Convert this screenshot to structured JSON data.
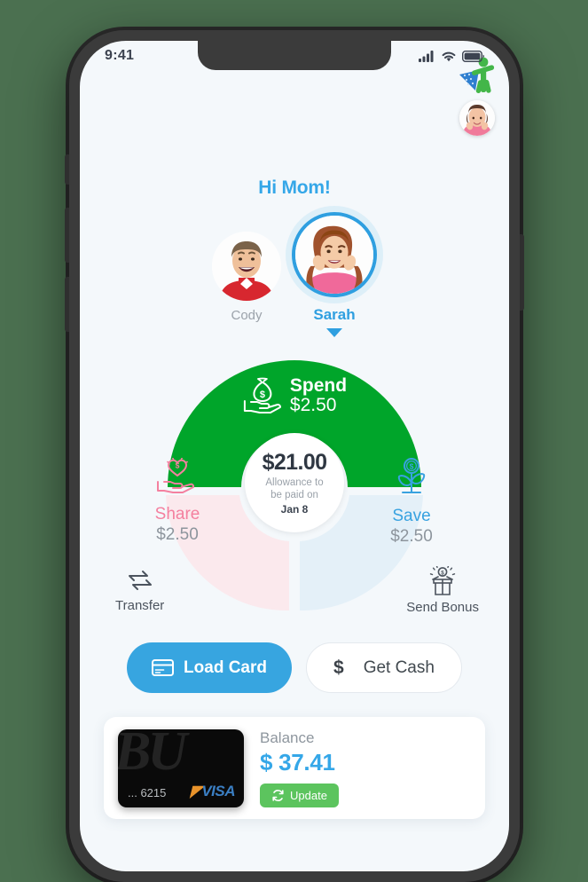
{
  "background_color": "#4b7050",
  "phone": {
    "status_bar": {
      "time": "9:41",
      "icons": [
        "cellular-signal-icon",
        "wifi-icon",
        "battery-icon"
      ]
    }
  },
  "header": {
    "greeting": "Hi Mom!",
    "app_badge_icon": "kid-with-money-logo",
    "parent_avatar_icon": "parent-avatar"
  },
  "kids": [
    {
      "name": "Cody",
      "active": false,
      "avatar_icon": "kid-avatar-cody"
    },
    {
      "name": "Sarah",
      "active": true,
      "avatar_icon": "kid-avatar-sarah"
    }
  ],
  "allowance": {
    "amount": "$21.00",
    "caption_line1": "Allowance to",
    "caption_line2": "be paid on",
    "date": "Jan 8"
  },
  "buckets": [
    {
      "key": "spend",
      "label": "Spend",
      "amount": "$2.50",
      "color": "#00a52a",
      "icon": "money-bag-in-hand-icon",
      "active": true
    },
    {
      "key": "share",
      "label": "Share",
      "amount": "$2.50",
      "color": "#f4809f",
      "fill": "#fbe9ed",
      "icon": "heart-in-hand-icon",
      "active": false
    },
    {
      "key": "save",
      "label": "Save",
      "amount": "$2.50",
      "color": "#38a2e0",
      "fill": "#e4f0f8",
      "icon": "money-plant-icon",
      "active": false
    }
  ],
  "quick_actions": [
    {
      "key": "transfer",
      "label": "Transfer",
      "icon": "transfer-arrows-icon"
    },
    {
      "key": "send_bonus",
      "label": "Send Bonus",
      "icon": "gift-bonus-icon"
    }
  ],
  "cta": {
    "load_card": {
      "label": "Load Card",
      "icon": "credit-card-icon",
      "color": "#37a5e0"
    },
    "get_cash": {
      "label": "Get Cash",
      "icon": "dollar-sign-icon"
    }
  },
  "balance_panel": {
    "card": {
      "last4": "... 6215",
      "network": "VISA",
      "art_text": "BU"
    },
    "balance_label": "Balance",
    "balance_amount": "$ 37.41",
    "update_button": {
      "label": "Update",
      "icon": "refresh-icon",
      "color": "#5cc45e"
    }
  },
  "chart_data": {
    "type": "pie",
    "title": "Allowance split",
    "categories": [
      "Spend",
      "Share",
      "Save"
    ],
    "values": [
      2.5,
      2.5,
      2.5
    ],
    "colors": [
      "#00a52a",
      "#fbe9ed",
      "#e4f0f8"
    ],
    "center_label": "$21.00",
    "legend": "inline"
  }
}
